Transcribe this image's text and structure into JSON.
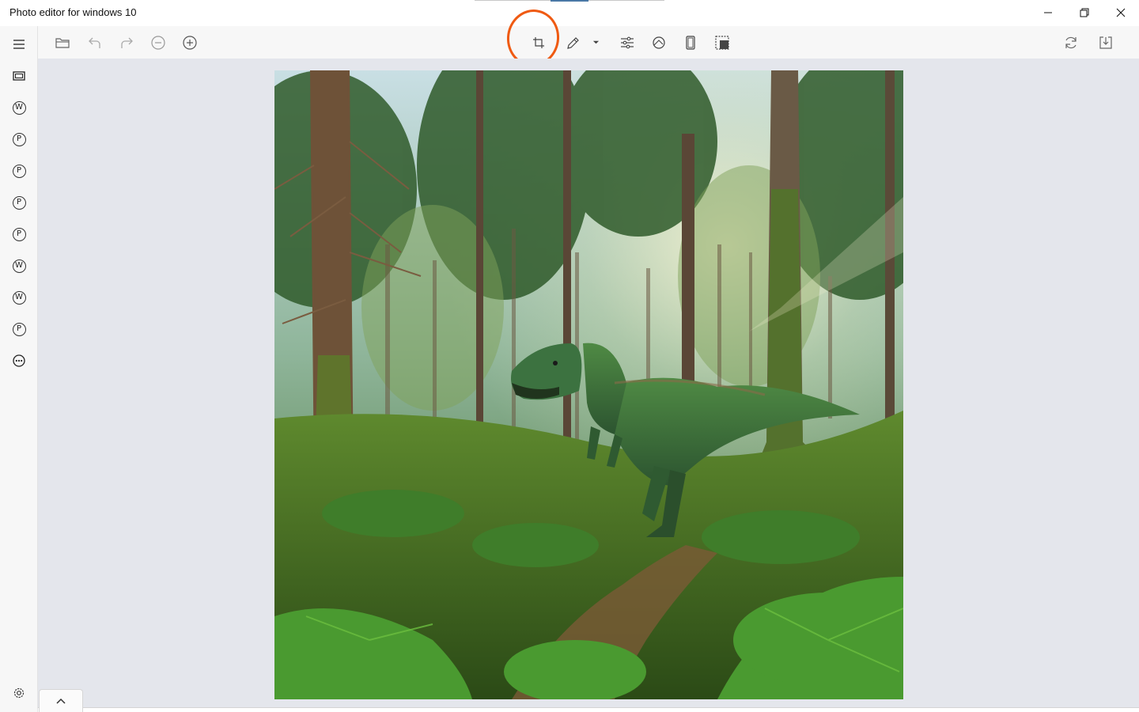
{
  "window": {
    "title": "Photo editor for windows 10",
    "controls": [
      "minimize-icon",
      "restore-icon",
      "close-icon"
    ]
  },
  "toolbar": {
    "left_tools": [
      "folder-open-icon",
      "undo-icon",
      "redo-icon",
      "zoom-out-icon",
      "zoom-in-icon"
    ],
    "center_tools": [
      "crop-rotate-icon",
      "pencil-icon",
      "chevron-down-icon",
      "adjustments-icon",
      "eraser-icon",
      "portrait-frame-icon",
      "selection-icon"
    ],
    "right_tools": [
      "refresh-icon",
      "save-download-icon"
    ],
    "highlighted_tool": "crop-rotate-icon",
    "highlight_color": "#ef5a12"
  },
  "sidebar": {
    "items": [
      {
        "name": "menu-icon"
      },
      {
        "name": "film-strip-icon"
      },
      {
        "name": "w-circle-icon",
        "letter": "W"
      },
      {
        "name": "p-circle-icon",
        "letter": "P"
      },
      {
        "name": "p-circle-icon",
        "letter": "P"
      },
      {
        "name": "p-circle-icon",
        "letter": "P"
      },
      {
        "name": "p-circle-icon",
        "letter": "P"
      },
      {
        "name": "w-circle-icon",
        "letter": "W"
      },
      {
        "name": "w-circle-icon",
        "letter": "W"
      },
      {
        "name": "p-circle-icon",
        "letter": "P"
      },
      {
        "name": "more-dots-icon"
      }
    ],
    "footer": "settings-icon"
  },
  "canvas": {
    "background": "#e4e6ec",
    "image": "forest-dinosaur-photo"
  },
  "bottom_panel": {
    "toggle": "chevron-up-icon"
  }
}
